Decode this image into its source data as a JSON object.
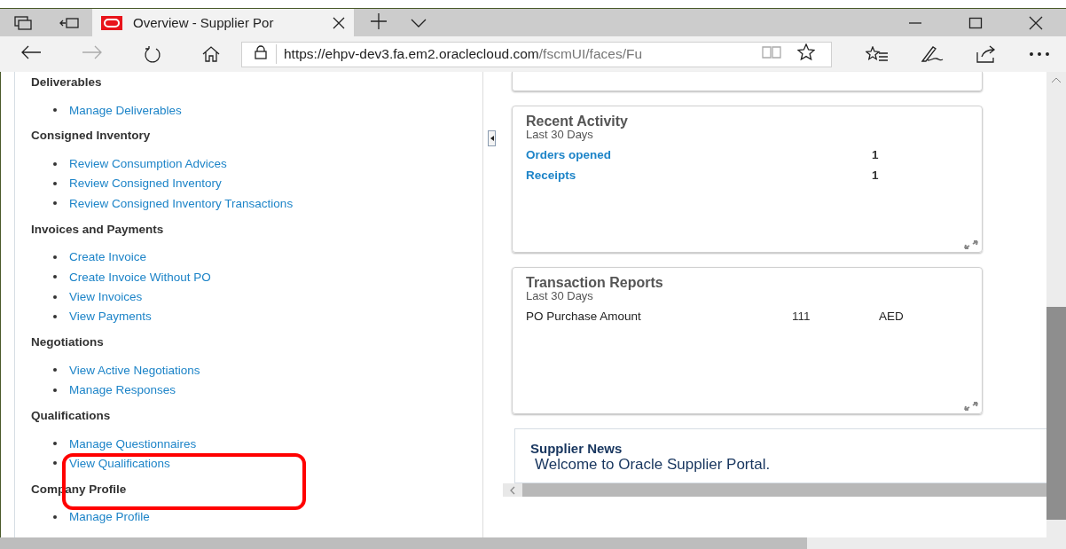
{
  "browser": {
    "tabs": [
      {
        "title": "Overview - Supplier Por",
        "selected": true
      }
    ],
    "url_host": "https://ehpv-dev3.fa.em2.oraclecloud.com",
    "url_path": "/fscmUI/faces/Fu"
  },
  "sections": [
    {
      "title": "Deliverables",
      "links": [
        "Manage Deliverables"
      ]
    },
    {
      "title": "Consigned Inventory",
      "links": [
        "Review Consumption Advices",
        "Review Consigned Inventory",
        "Review Consigned Inventory Transactions"
      ]
    },
    {
      "title": "Invoices and Payments",
      "links": [
        "Create Invoice",
        "Create Invoice Without PO",
        "View Invoices",
        "View Payments"
      ]
    },
    {
      "title": "Negotiations",
      "links": [
        "View Active Negotiations",
        "Manage Responses"
      ]
    },
    {
      "title": "Qualifications",
      "links": [
        "Manage Questionnaires",
        "View Qualifications"
      ]
    },
    {
      "title": "Company Profile",
      "links": [
        "Manage Profile"
      ]
    }
  ],
  "cards": [
    {
      "title": "Recent Activity",
      "subtitle": "Last 30 Days",
      "rows": [
        {
          "kind": "link",
          "label": "Orders opened",
          "value": "1"
        },
        {
          "kind": "link",
          "label": "Receipts",
          "value": "1"
        }
      ]
    },
    {
      "title": "Transaction Reports",
      "subtitle": "Last 30 Days",
      "rows": [
        {
          "kind": "text",
          "label": "PO Purchase Amount",
          "value": "111",
          "unit": "AED"
        }
      ]
    }
  ],
  "news": {
    "title": "Supplier News",
    "message": "Welcome to Oracle Supplier Portal."
  }
}
